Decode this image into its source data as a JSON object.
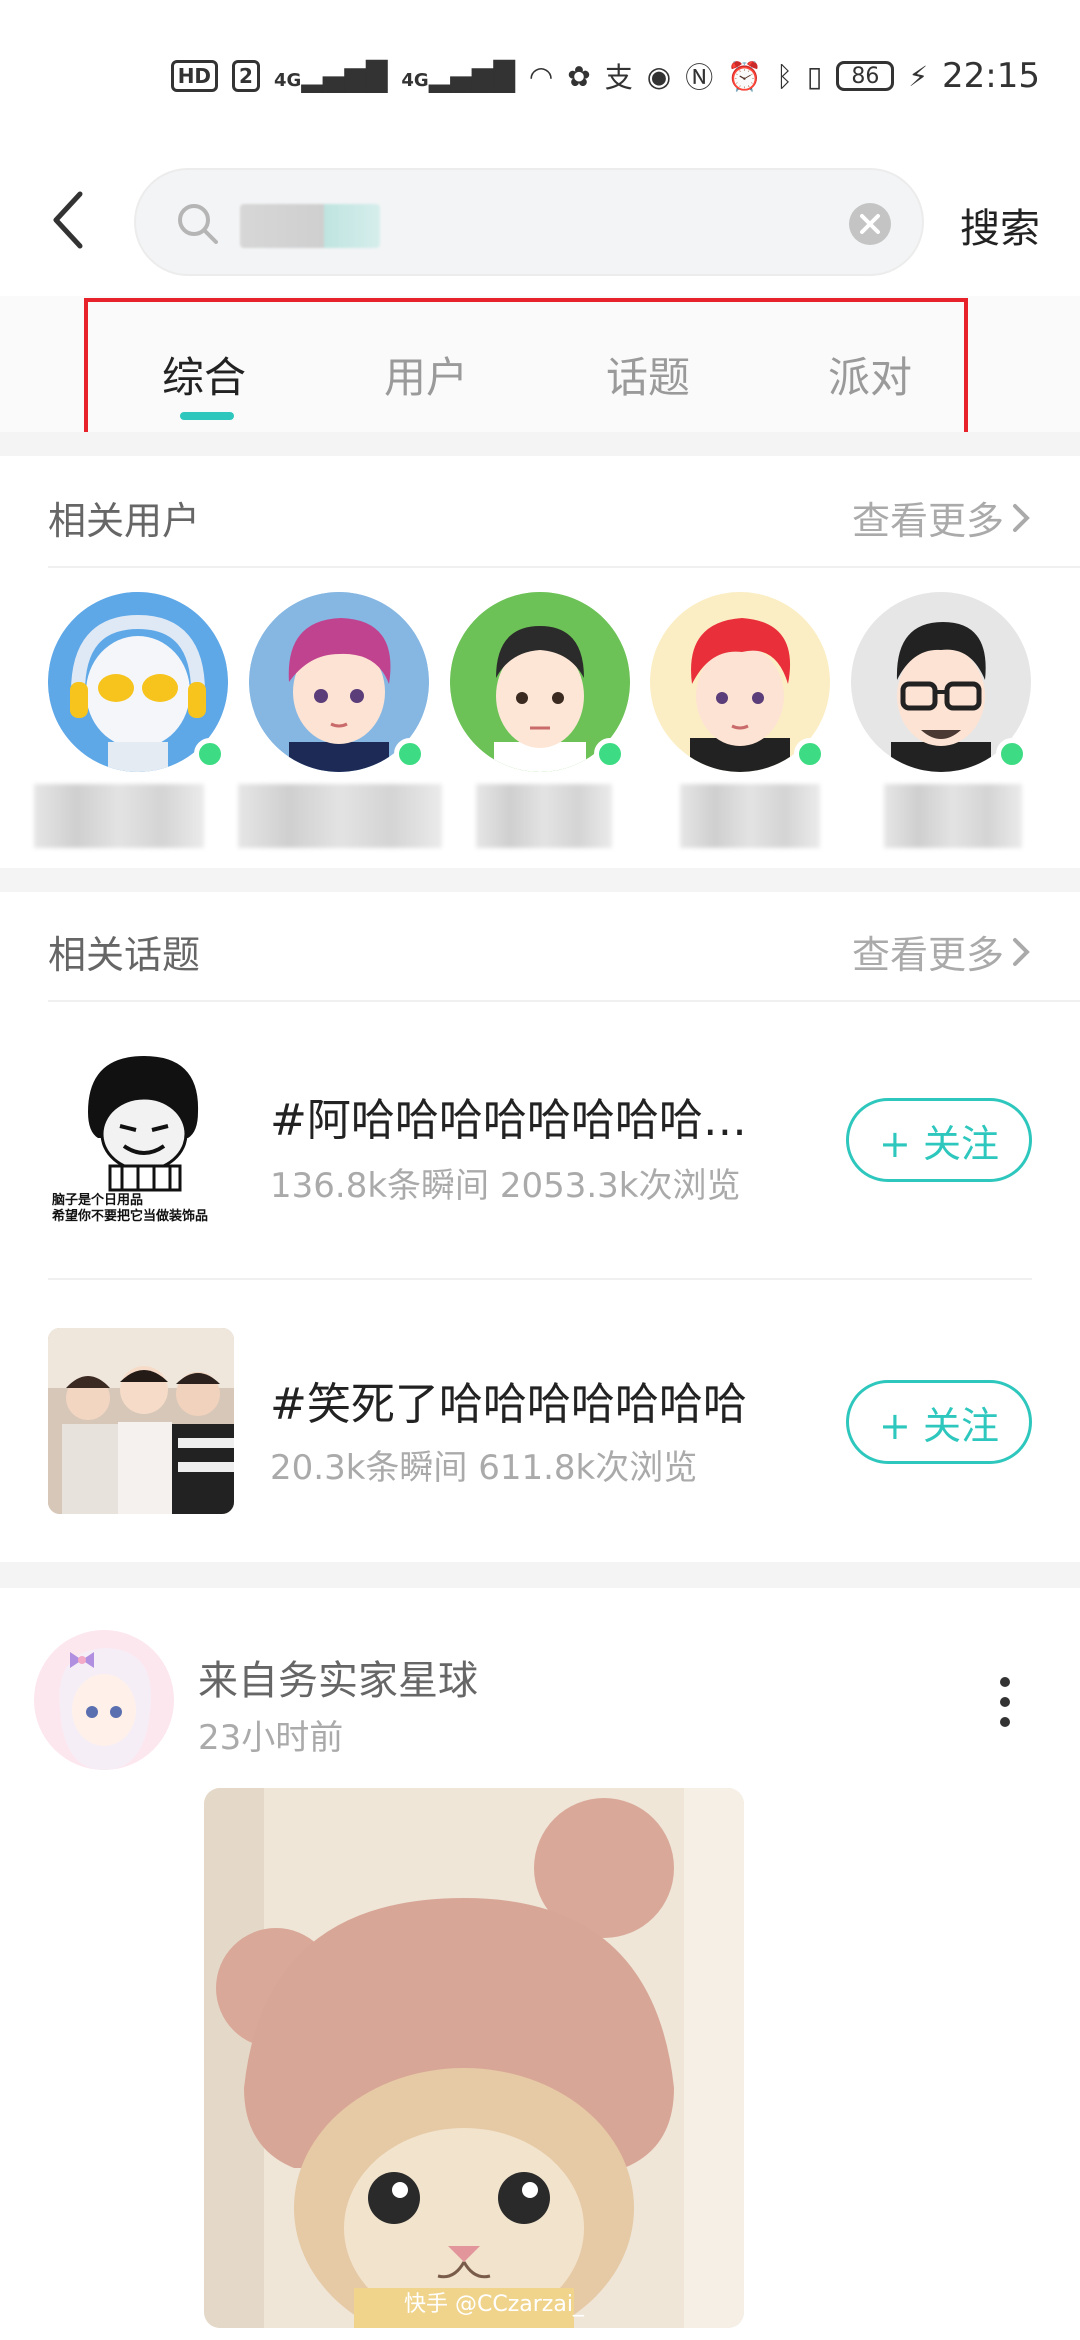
{
  "status_bar": {
    "hd": "HD",
    "sim_badge": "2",
    "network_1": "4G",
    "network_2": "4G",
    "battery": "86",
    "time": "22:15"
  },
  "search": {
    "submit_label": "搜索"
  },
  "tabs": [
    {
      "label": "综合",
      "active": true
    },
    {
      "label": "用户",
      "active": false
    },
    {
      "label": "话题",
      "active": false
    },
    {
      "label": "派对",
      "active": false
    }
  ],
  "related_users": {
    "title": "相关用户",
    "see_more": "查看更多"
  },
  "related_topics": {
    "title": "相关话题",
    "see_more": "查看更多",
    "items": [
      {
        "title": "#阿哈哈哈哈哈哈哈哈…",
        "stats": "136.8k条瞬间   2053.3k次浏览",
        "follow_label": "+ 关注",
        "thumb_caption_1": "脑子是个日用品",
        "thumb_caption_2": "希望你不要把它当做装饰品"
      },
      {
        "title": "#笑死了哈哈哈哈哈哈哈",
        "stats": "20.3k条瞬间   611.8k次浏览",
        "follow_label": "+ 关注"
      }
    ]
  },
  "post": {
    "author": "来自务实家星球",
    "time": "23小时前",
    "watermark": "快手 @CCzarzai_"
  },
  "colors": {
    "accent": "#2ec7bd",
    "online": "#3ddc84",
    "highlight": "#e8222a"
  }
}
